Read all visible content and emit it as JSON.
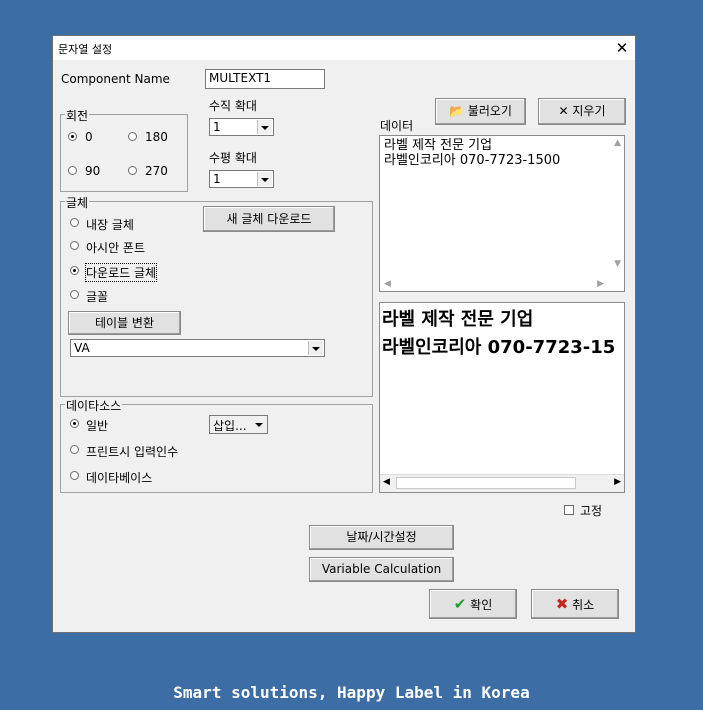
{
  "window": {
    "title": "문자열 설정",
    "close_glyph": "✕"
  },
  "component": {
    "label": "Component Name",
    "value": "MULTEXT1"
  },
  "rotation": {
    "legend": "회전",
    "options": [
      "0",
      "180",
      "90",
      "270"
    ],
    "selected": "0"
  },
  "scale": {
    "vertical_label": "수직 확대",
    "vertical_value": "1",
    "horizontal_label": "수평 확대",
    "horizontal_value": "1"
  },
  "font": {
    "legend": "글체",
    "options": [
      "내장 글체",
      "아시안 폰트",
      "다운로드 글체",
      "글꼴"
    ],
    "selected": "다운로드 글체",
    "download_button": "새 글체 다운로드",
    "table_convert_button": "테이블 변환",
    "font_select_value": "VA"
  },
  "data_source": {
    "legend": "데이타소스",
    "options": [
      "일반",
      "프린트시 입력인수",
      "데이타베이스"
    ],
    "selected": "일반",
    "insert_button": "삽입..."
  },
  "data": {
    "label": "데이터",
    "load_button": "불러오기",
    "clear_button": "지우기",
    "lines": [
      "라벨 제작 전문 기업",
      "라벨인코리아 070-7723-1500"
    ]
  },
  "preview": {
    "lines": [
      "라벨 제작 전문 기업",
      "라벨인코리아 070-7723-15"
    ]
  },
  "fixed_label": "고정",
  "buttons": {
    "datetime": "날짜/시간설정",
    "variable_calc": "Variable Calculation",
    "ok": "확인",
    "cancel": "취소"
  },
  "footer": "Smart solutions, Happy Label in Korea",
  "colors": {
    "background": "#3c6ea5",
    "ok_check": "#1e9e2e",
    "cancel_x": "#c0281e"
  }
}
